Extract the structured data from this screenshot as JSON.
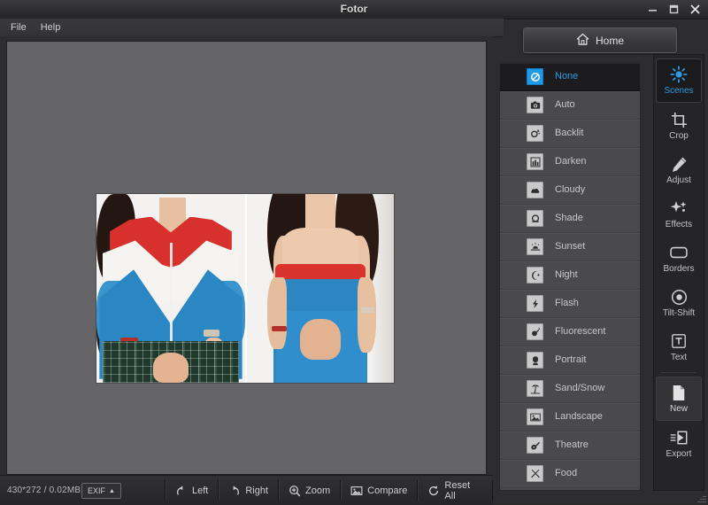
{
  "window": {
    "title": "Fotor",
    "controls": [
      {
        "name": "minimize-button",
        "glyph": "minimize"
      },
      {
        "name": "maximize-button",
        "glyph": "maximize"
      },
      {
        "name": "close-button",
        "glyph": "close"
      }
    ]
  },
  "menubar": {
    "items": [
      {
        "label": "File"
      },
      {
        "label": "Help"
      }
    ]
  },
  "canvas": {
    "photo_alt": "Two side-by-side photos of a model wearing a red-white-blue jacket with plaid skirt, and a red-and-blue strapless dress"
  },
  "statusbar": {
    "image_info": "430*272 / 0.02MB",
    "exif_label": "EXIF",
    "exif_caret": "▲",
    "tools": [
      {
        "label": "Left",
        "icon": "rotate-left-icon"
      },
      {
        "label": "Right",
        "icon": "rotate-right-icon"
      },
      {
        "label": "Zoom",
        "icon": "zoom-in-icon"
      },
      {
        "label": "Compare",
        "icon": "compare-image-icon"
      },
      {
        "label": "Reset All",
        "icon": "reset-icon"
      }
    ]
  },
  "home": {
    "label": "Home",
    "icon": "home-icon"
  },
  "scenes": {
    "items": [
      {
        "label": "None",
        "icon": "no-entry-icon",
        "selected": true
      },
      {
        "label": "Auto",
        "icon": "camera-icon",
        "selected": false
      },
      {
        "label": "Backlit",
        "icon": "backlit-sun-icon",
        "selected": false
      },
      {
        "label": "Darken",
        "icon": "building-icon",
        "selected": false
      },
      {
        "label": "Cloudy",
        "icon": "cloud-icon",
        "selected": false
      },
      {
        "label": "Shade",
        "icon": "shade-icon",
        "selected": false
      },
      {
        "label": "Sunset",
        "icon": "sunset-icon",
        "selected": false
      },
      {
        "label": "Night",
        "icon": "moon-star-icon",
        "selected": false
      },
      {
        "label": "Flash",
        "icon": "lightning-icon",
        "selected": false
      },
      {
        "label": "Fluorescent",
        "icon": "bulb-icon",
        "selected": false
      },
      {
        "label": "Portrait",
        "icon": "portrait-icon",
        "selected": false
      },
      {
        "label": "Sand/Snow",
        "icon": "palm-tree-icon",
        "selected": false
      },
      {
        "label": "Landscape",
        "icon": "landscape-icon",
        "selected": false
      },
      {
        "label": "Theatre",
        "icon": "guitar-icon",
        "selected": false
      },
      {
        "label": "Food",
        "icon": "cutlery-icon",
        "selected": false
      }
    ]
  },
  "rail": {
    "items": [
      {
        "label": "Scenes",
        "icon": "brightness-sun-icon",
        "state": "active"
      },
      {
        "label": "Crop",
        "icon": "crop-icon",
        "state": "normal"
      },
      {
        "label": "Adjust",
        "icon": "pencil-icon",
        "state": "normal"
      },
      {
        "label": "Effects",
        "icon": "sparkles-icon",
        "state": "normal"
      },
      {
        "label": "Borders",
        "icon": "rounded-frame-icon",
        "state": "normal"
      },
      {
        "label": "Tilt-Shift",
        "icon": "target-circle-icon",
        "state": "normal"
      },
      {
        "label": "Text",
        "icon": "text-t-icon",
        "state": "normal"
      },
      {
        "label": "New",
        "icon": "new-document-icon",
        "state": "subtle-active"
      },
      {
        "label": "Export",
        "icon": "export-icon",
        "state": "normal"
      }
    ]
  },
  "colors": {
    "accent_blue": "#2e9ae0",
    "icon_tile": "#c9c9c9",
    "panel_bg": "#4a4a4c",
    "rail_bg": "#252527",
    "canvas_bg": "#656567",
    "titlebar_bg": "#313133"
  }
}
